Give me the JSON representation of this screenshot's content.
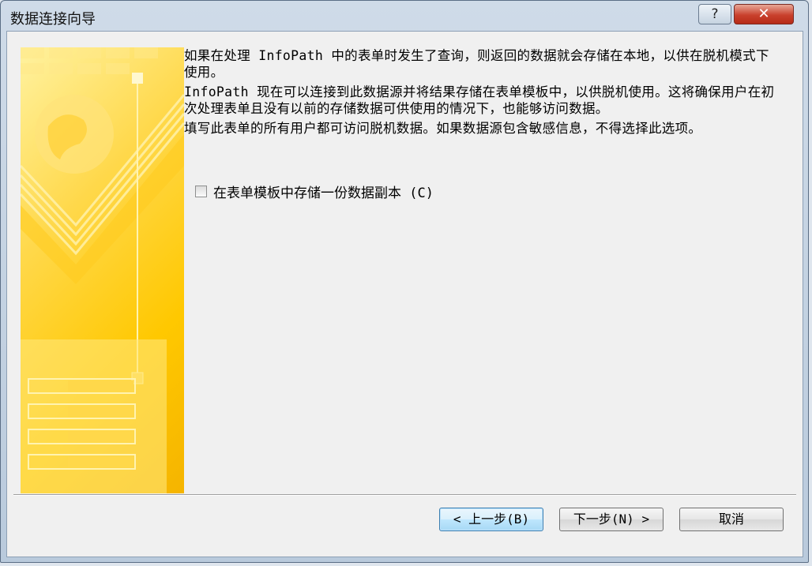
{
  "window": {
    "title": "数据连接向导",
    "help_glyph": "?",
    "close_glyph": "✕"
  },
  "content": {
    "paragraph1": "如果在处理 InfoPath 中的表单时发生了查询，则返回的数据就会存储在本地，以供在脱机模式下\n使用。",
    "paragraph2": "InfoPath 现在可以连接到此数据源并将结果存储在表单模板中，以供脱机使用。这将确保用户在初次处理表单且没有以前的存储数据可供使用的情况下，也能够访问数据。",
    "paragraph3": "填写此表单的所有用户都可访问脱机数据。如果数据源包含敏感信息，不得选择此选项。",
    "checkbox_label": "在表单模板中存储一份数据副本 (C)",
    "checkbox_checked": false
  },
  "buttons": {
    "back": "< 上一步(B)",
    "next": "下一步(N) >",
    "cancel": "取消"
  },
  "colors": {
    "banner_light": "#fff2a0",
    "banner_dark": "#f5b400",
    "default_button_border": "#3c7fb1"
  }
}
